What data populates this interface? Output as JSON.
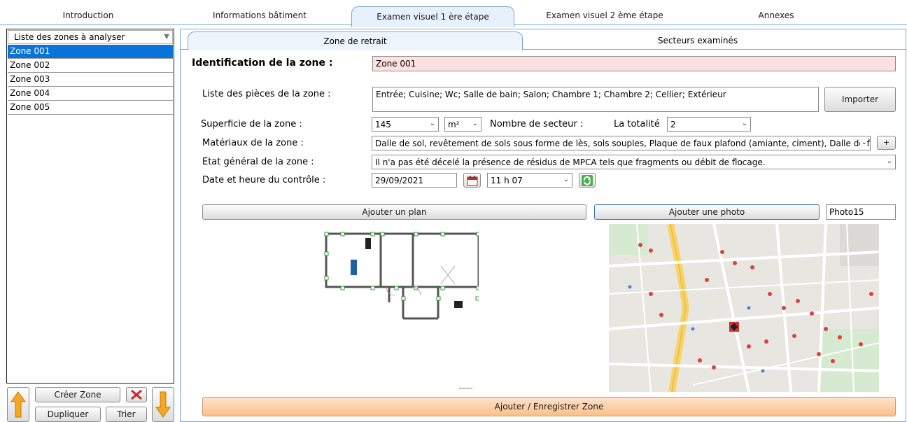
{
  "top_tabs": [
    "Introduction",
    "Informations bâtiment",
    "Examen visuel 1 ère étape",
    "Examen visuel 2 ème étape",
    "Annexes"
  ],
  "zones": {
    "header": "Liste des zones à analyser",
    "items": [
      "Zone 001",
      "Zone 002",
      "Zone 003",
      "Zone 004",
      "Zone 005"
    ]
  },
  "left_buttons": {
    "create": "Créer Zone",
    "duplicate": "Dupliquer",
    "sort": "Trier"
  },
  "sub_tabs": [
    "Zone de retrait",
    "Secteurs examinés"
  ],
  "form": {
    "id_label": "Identification de la zone :",
    "id_value": "Zone 001",
    "rooms_label": "Liste des pièces de la zone :",
    "rooms_value": "Entrée; Cuisine; Wc; Salle de bain; Salon; Chambre 1; Chambre 2; Cellier; Extérieur",
    "import_button": "Importer",
    "area_label": "Superficie de la zone :",
    "area_value": "145",
    "area_unit": "m²",
    "sectors_label": "Nombre de secteur :",
    "totality_label": "La totalité",
    "sectors_value": "2",
    "materials_label": "Matériaux de la zone :",
    "materials_value": "Dalle de sol, revêtement de sols sous forme de lès, sols souples,  Plaque de faux plafond (amiante, ciment),  Dalle de faux plafond (pan",
    "materials_add": "+",
    "state_label": "Etat général de la zone :",
    "state_value": "Il n'a pas été décelé la présence de résidus de MPCA tels que fragments ou débit de flocage.",
    "date_label": "Date et heure du contrôle :",
    "date_value": "29/09/2021",
    "time_value": "11 h 07"
  },
  "plan_button": "Ajouter un plan",
  "photo_button": "Ajouter une photo",
  "photo_name": "Photo15",
  "save_button": "Ajouter / Enregistrer Zone",
  "colors": {
    "selection": "#0a73d9",
    "id_field_bg": "#fde0e0",
    "save_button": "#fbc08a",
    "accent_border": "#7aa5d4"
  }
}
